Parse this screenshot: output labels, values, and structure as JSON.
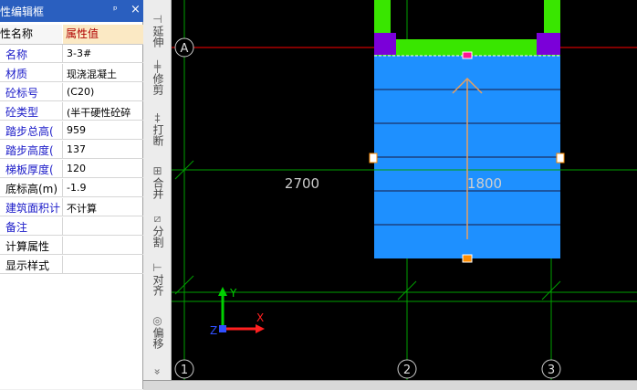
{
  "panel": {
    "title": "性编辑框",
    "pin": "ᵖ",
    "close": "×",
    "header": {
      "name": "性名称",
      "value": "属性值"
    },
    "rows": [
      {
        "name": "名称",
        "value": "3-3#"
      },
      {
        "name": "材质",
        "value": "现浇混凝土"
      },
      {
        "name": "砼标号",
        "value": "(C20)"
      },
      {
        "name": "砼类型",
        "value": "(半干硬性砼碎"
      },
      {
        "name": "踏步总高(",
        "value": "959"
      },
      {
        "name": "踏步高度(",
        "value": "137"
      },
      {
        "name": "梯板厚度(",
        "value": "120"
      },
      {
        "name": "底标高(m)",
        "value": "-1.9"
      },
      {
        "name": "建筑面积计",
        "value": "不计算"
      },
      {
        "name": "备注",
        "value": ""
      },
      {
        "name": "计算属性",
        "value": ""
      },
      {
        "name": "显示样式",
        "value": ""
      }
    ]
  },
  "toolbar": {
    "extend": "延伸",
    "trim": "修剪",
    "break": "打断",
    "merge": "合并",
    "split": "分割",
    "align": "对齐",
    "offset": "偏移",
    "more": "»"
  },
  "canvas": {
    "axis_a": "A",
    "axis_1": "1",
    "axis_2": "2",
    "axis_3": "3",
    "dim_left": "2700",
    "dim_right": "1800",
    "ucs_y": "Y",
    "ucs_x": "X",
    "ucs_z": "Z"
  },
  "colors": {
    "stair_fill": "#1e90ff",
    "grid": "#00a000",
    "beam": "#39e600",
    "column": "#7b00d9",
    "axis_line": "#ff0000",
    "arrow": "#e8a060",
    "panel_title": "#2a5fbf"
  }
}
